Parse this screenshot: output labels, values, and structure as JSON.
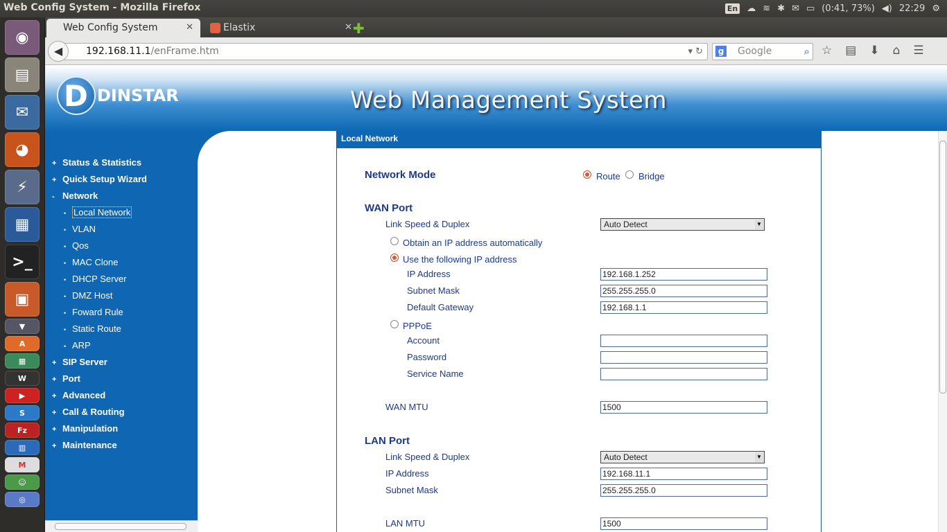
{
  "window_title": "Web Config System - Mozilla Firefox",
  "tray": {
    "keyboard": "En",
    "battery": "(0:41, 73%)",
    "time": "22:29"
  },
  "tabs": [
    {
      "label": "Web Config System"
    },
    {
      "label": "Elastix"
    }
  ],
  "url": {
    "host": "192.168.11.1",
    "path": "/enFrame.htm"
  },
  "search": {
    "placeholder": "Google"
  },
  "banner": {
    "logo_text": "DINSTAR",
    "title": "Web Management System"
  },
  "sidebar": {
    "items": [
      {
        "label": "Status & Statistics",
        "bullet": "+"
      },
      {
        "label": "Quick Setup Wizard",
        "bullet": "+"
      },
      {
        "label": "Network",
        "bullet": "-"
      },
      {
        "label": "Local Network",
        "bullet": "•"
      },
      {
        "label": "VLAN",
        "bullet": "•"
      },
      {
        "label": "Qos",
        "bullet": "•"
      },
      {
        "label": "MAC Clone",
        "bullet": "•"
      },
      {
        "label": "DHCP Server",
        "bullet": "•"
      },
      {
        "label": "DMZ Host",
        "bullet": "•"
      },
      {
        "label": "Foward Rule",
        "bullet": "•"
      },
      {
        "label": "Static Route",
        "bullet": "•"
      },
      {
        "label": "ARP",
        "bullet": "•"
      },
      {
        "label": "SIP Server",
        "bullet": "+"
      },
      {
        "label": "Port",
        "bullet": "+"
      },
      {
        "label": "Advanced",
        "bullet": "+"
      },
      {
        "label": "Call & Routing",
        "bullet": "+"
      },
      {
        "label": "Manipulation",
        "bullet": "+"
      },
      {
        "label": "Maintenance",
        "bullet": "+"
      }
    ]
  },
  "panel": {
    "header": "Local Network",
    "network_mode": {
      "label": "Network Mode",
      "route": "Route",
      "bridge": "Bridge"
    },
    "wan": {
      "title": "WAN Port",
      "link_speed_label": "Link Speed & Duplex",
      "link_speed_value": "Auto Detect",
      "obtain_auto": "Obtain an IP address automatically",
      "use_following": "Use the following IP address",
      "ip_label": "IP Address",
      "ip_value": "192.168.1.252",
      "mask_label": "Subnet Mask",
      "mask_value": "255.255.255.0",
      "gw_label": "Default Gateway",
      "gw_value": "192.168.1.1",
      "pppoe": "PPPoE",
      "account_label": "Account",
      "account_value": "",
      "password_label": "Password",
      "password_value": "",
      "service_label": "Service Name",
      "service_value": "",
      "mtu_label": "WAN MTU",
      "mtu_value": "1500"
    },
    "lan": {
      "title": "LAN Port",
      "link_speed_label": "Link Speed & Duplex",
      "link_speed_value": "Auto Detect",
      "ip_label": "IP Address",
      "ip_value": "192.168.11.1",
      "mask_label": "Subnet Mask",
      "mask_value": "255.255.255.0",
      "mtu_label": "LAN MTU",
      "mtu_value": "1500"
    }
  }
}
